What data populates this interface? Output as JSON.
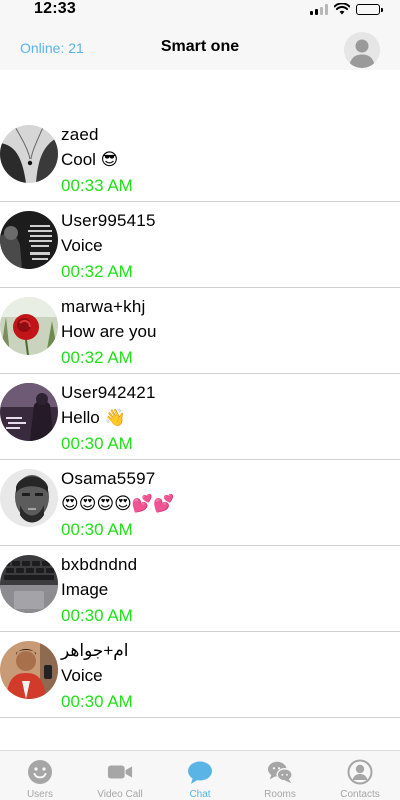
{
  "status_bar": {
    "time": "12:33",
    "battery": 1.0
  },
  "header": {
    "online": "Online: 21",
    "title": "Smart one"
  },
  "chats": [
    {
      "name": "zaed",
      "message": "Cool 😎",
      "time": "00:33 AM"
    },
    {
      "name": "User995415",
      "message": "Voice",
      "time": "00:32 AM"
    },
    {
      "name": "marwa+khj",
      "message": "How are you",
      "time": "00:32 AM"
    },
    {
      "name": "User942421",
      "message": "Hello 👋",
      "time": "00:30 AM"
    },
    {
      "name": "Osama5597",
      "message": "😍😍😍😍💕💕",
      "time": "00:30 AM"
    },
    {
      "name": "bxbdndnd",
      "message": "Image",
      "time": "00:30 AM"
    },
    {
      "name": "ام+جواهر",
      "message": "Voice",
      "time": "00:30 AM"
    }
  ],
  "tabs": [
    {
      "label": "Users",
      "icon": "smiley-icon",
      "active": false
    },
    {
      "label": "Video Call",
      "icon": "video-camera-icon",
      "active": false
    },
    {
      "label": "Chat",
      "icon": "chat-bubble-icon",
      "active": true
    },
    {
      "label": "Rooms",
      "icon": "rooms-icon",
      "active": false
    },
    {
      "label": "Contacts",
      "icon": "contacts-icon",
      "active": false
    }
  ],
  "colors": {
    "accent": "#5ab4e6",
    "time_green": "#22e01a",
    "inactive_gray": "#a6a6a6",
    "bar_background": "#f7f7f7"
  }
}
